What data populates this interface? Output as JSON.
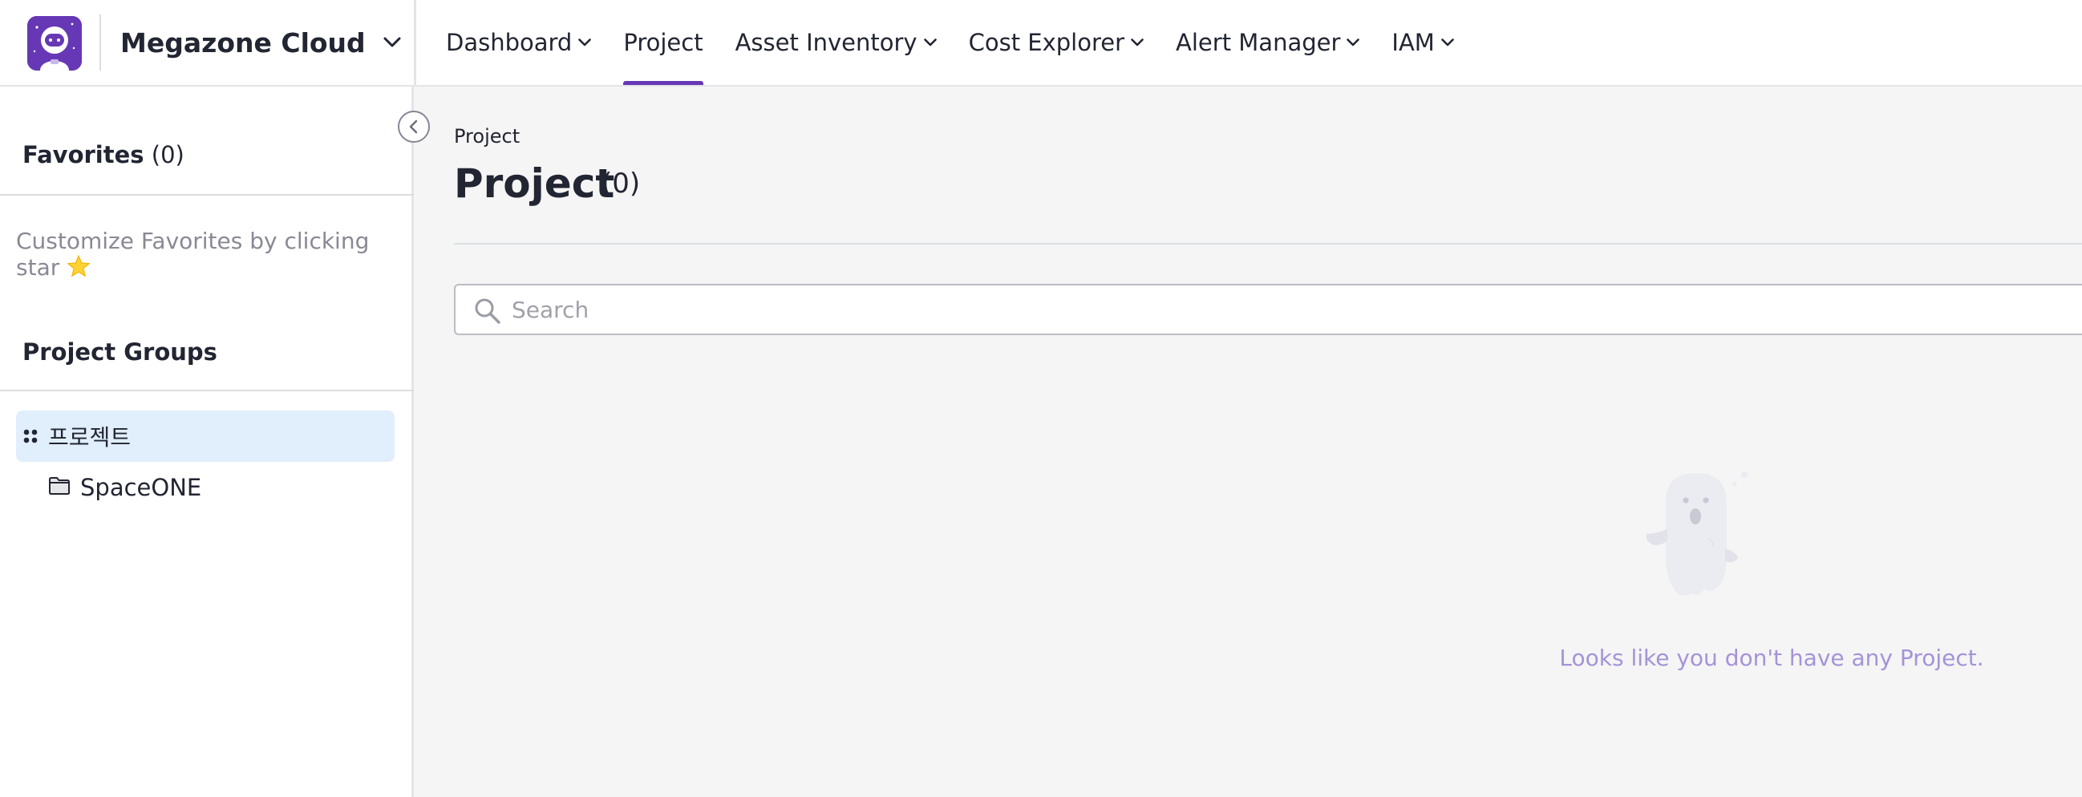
{
  "brand": {
    "name": "Megazone Cloud",
    "accent": "#6638b6",
    "logo_icon": "astronaut-logo-icon"
  },
  "nav": {
    "items": [
      {
        "label": "Dashboard",
        "has_caret": true
      },
      {
        "label": "Project",
        "has_caret": false,
        "active": true
      },
      {
        "label": "Asset Inventory",
        "has_caret": true
      },
      {
        "label": "Cost Explorer",
        "has_caret": true
      },
      {
        "label": "Alert Manager",
        "has_caret": true
      },
      {
        "label": "IAM",
        "has_caret": true
      }
    ]
  },
  "sidebar": {
    "favorites_label": "Favorites",
    "favorites_count": "(0)",
    "favorites_hint": "Customize Favorites by clicking star",
    "groups_label": "Project Groups",
    "group_root": "프로젝트",
    "folder_item": "SpaceONE"
  },
  "main": {
    "breadcrumb": "Project",
    "title": "Project",
    "count": "(0)",
    "search_placeholder": "Search",
    "empty_message": "Looks like you don't have any Project."
  }
}
